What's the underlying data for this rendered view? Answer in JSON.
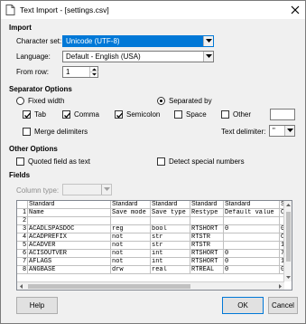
{
  "window": {
    "title": "Text Import - [settings.csv]"
  },
  "import": {
    "section_title": "Import",
    "charset_label": "Character set:",
    "charset_value": "Unicode (UTF-8)",
    "language_label": "Language:",
    "language_value": "Default - English (USA)",
    "fromrow_label": "From row:",
    "fromrow_value": "1"
  },
  "separator": {
    "section_title": "Separator Options",
    "fixed_width_label": "Fixed width",
    "separated_by_label": "Separated by",
    "tab_label": "Tab",
    "comma_label": "Comma",
    "semicolon_label": "Semicolon",
    "space_label": "Space",
    "other_label": "Other",
    "merge_label": "Merge delimiters",
    "text_delim_label": "Text delimiter:",
    "text_delim_value": "\""
  },
  "other": {
    "section_title": "Other Options",
    "quoted_label": "Quoted field as text",
    "detect_label": "Detect special numbers"
  },
  "fields": {
    "section_title": "Fields",
    "column_type_label": "Column type:",
    "header_row": [
      "",
      "Standard",
      "Standard",
      "Standard",
      "Standard",
      "Standard",
      "Standa"
    ],
    "rows": [
      [
        "1",
        "Name",
        "Save mode",
        "Save type",
        "Restype",
        "Default value",
        "Cur"
      ],
      [
        "2",
        "",
        "",
        "",
        "",
        "",
        ""
      ],
      [
        "3",
        "ACADLSPASDOC",
        "reg",
        "bool",
        "RTSHORT",
        "0",
        "0"
      ],
      [
        "4",
        "ACADPREFIX",
        "not",
        "str",
        "RTSTR",
        "",
        "C:\\"
      ],
      [
        "5",
        "ACADVER",
        "not",
        "str",
        "RTSTR",
        "",
        "19."
      ],
      [
        "6",
        "ACISOUTVER",
        "not",
        "int",
        "RTSHORT",
        "0",
        "70"
      ],
      [
        "7",
        "AFLAGS",
        "not",
        "int",
        "RTSHORT",
        "0",
        "16"
      ],
      [
        "8",
        "ANGBASE",
        "drw",
        "real",
        "RTREAL",
        "0",
        "0"
      ]
    ]
  },
  "buttons": {
    "help": "Help",
    "ok": "OK",
    "cancel": "Cancel"
  },
  "colors": {
    "accent": "#0078d7",
    "window_bg": "#f0f0f0"
  }
}
